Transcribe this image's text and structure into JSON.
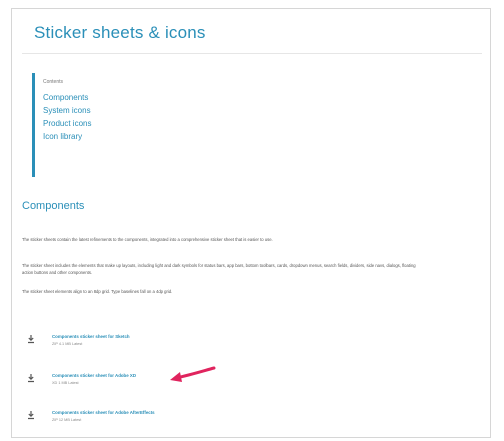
{
  "page": {
    "title": "Sticker sheets & icons"
  },
  "toc": {
    "heading": "Contents",
    "items": [
      {
        "label": "Components"
      },
      {
        "label": "System icons"
      },
      {
        "label": "Product icons"
      },
      {
        "label": "Icon library"
      }
    ]
  },
  "section": {
    "title": "Components",
    "paragraphs": [
      "The sticker sheets contain the latest refinements to the components, integrated into a comprehensive sticker sheet that is easier to use.",
      "The sticker sheet includes the elements that make up layouts, including light and dark symbols for status bars, app bars, bottom toolbars, cards, dropdown menus, search fields, dividers, side navs, dialogs, floating action buttons and other components.",
      "The sticker sheet elements align to an 8dp grid. Type baselines fall on a 4dp grid."
    ]
  },
  "downloads": [
    {
      "title": "Components sticker sheet for Sketch",
      "meta": "ZIP 4.1 MB  Latest"
    },
    {
      "title": "Components sticker sheet for Adobe XD",
      "meta": "XD 1 MB  Latest"
    },
    {
      "title": "Components sticker sheet for Adobe AfterEffects",
      "meta": "ZIP 12 MB  Latest"
    }
  ],
  "colors": {
    "accent": "#2a8fb8",
    "annotation_arrow": "#e0245e"
  },
  "icons": {
    "download": "download-icon"
  }
}
